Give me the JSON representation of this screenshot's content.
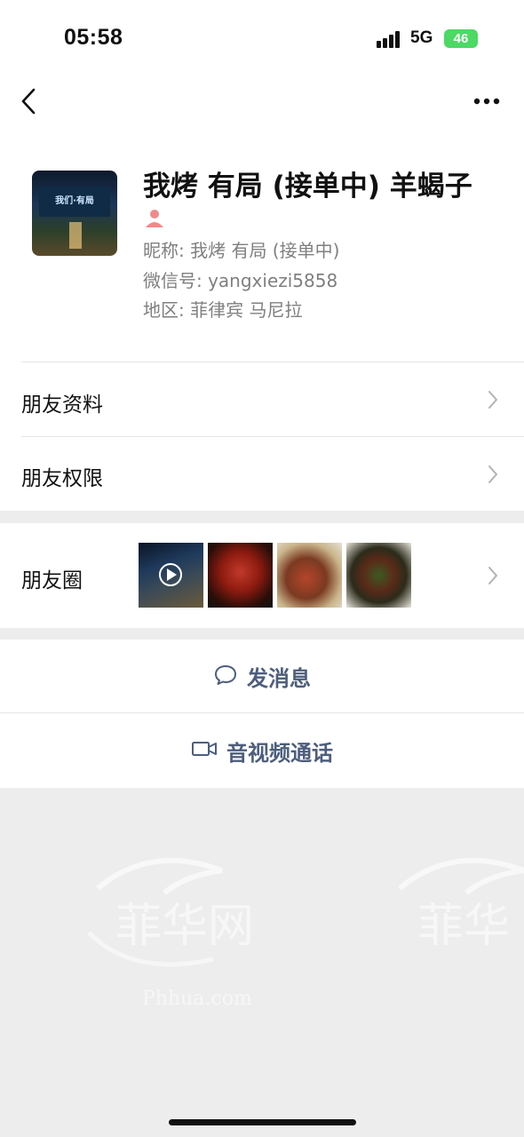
{
  "status_bar": {
    "time": "05:58",
    "network": "5G",
    "battery": "46"
  },
  "profile": {
    "name": "我烤 有局 (接单中) 羊蝎子",
    "nickname": "昵称: 我烤 有局 (接单中)",
    "wechat_id": "微信号: yangxiezi5858",
    "region": "地区: 菲律宾 马尼拉",
    "avatar_sign_text": "我们·有局"
  },
  "rows": {
    "friend_profile": "朋友资料",
    "friend_permissions": "朋友权限",
    "moments": "朋友圈"
  },
  "actions": {
    "send_message": "发消息",
    "video_call": "音视频通话"
  },
  "watermark": {
    "text": "Phhua.com"
  },
  "colors": {
    "action_text": "#4d5e7c",
    "battery": "#4cd964",
    "background": "#ededed",
    "gender_icon": "#f08a8a"
  }
}
